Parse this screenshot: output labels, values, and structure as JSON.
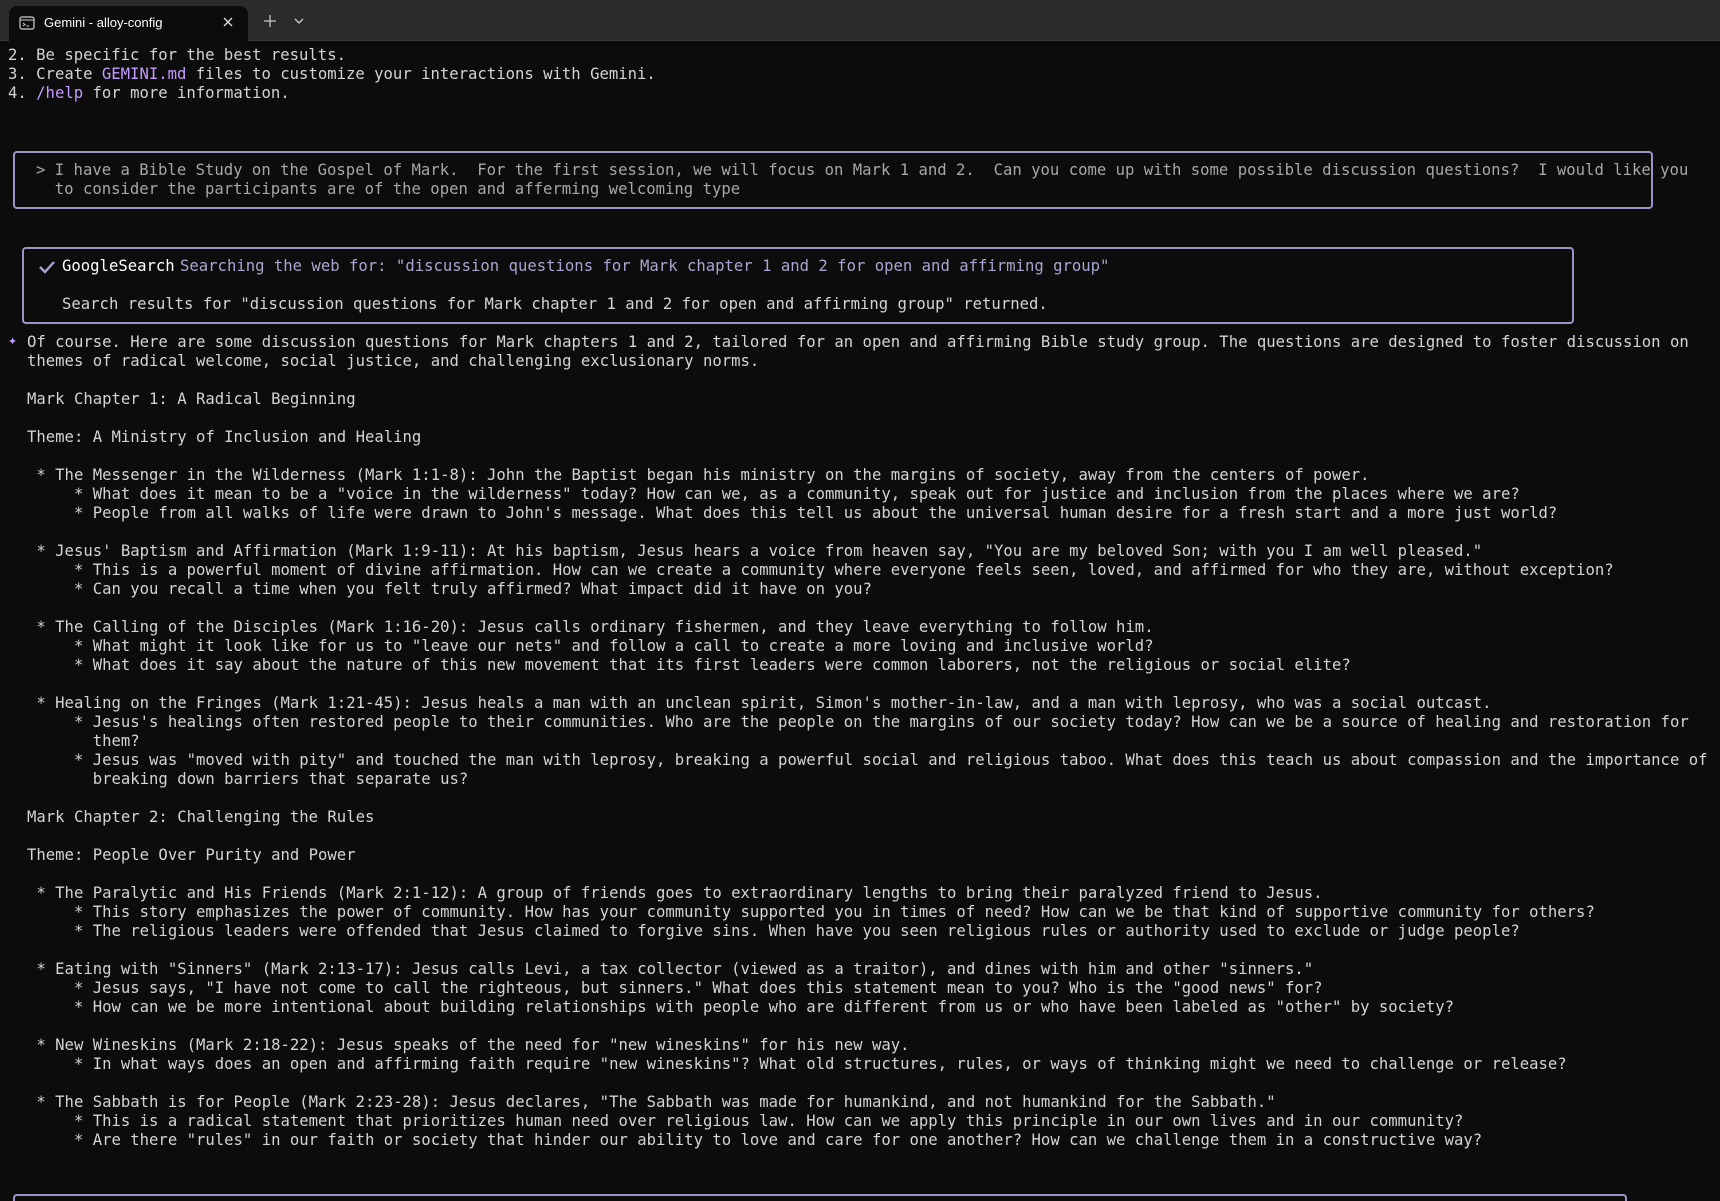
{
  "window": {
    "tab_title": "Gemini - alloy-config",
    "icons": {
      "tab": "terminal-icon",
      "close": "close-icon",
      "new_tab": "plus-icon",
      "dropdown": "chevron-down-icon"
    }
  },
  "colors": {
    "background": "#0c0c0c",
    "accent": "#c49bff",
    "box_border": "#9a95c9"
  },
  "tips": {
    "line2": "2. Be specific for the best results.",
    "line3_prefix": "3. Create ",
    "line3_link": "GEMINI.md",
    "line3_suffix": " files to customize your interactions with Gemini.",
    "line4_prefix": "4. ",
    "line4_link": "/help",
    "line4_suffix": " for more information."
  },
  "user_prompt": {
    "line1": "> I have a Bible Study on the Gospel of Mark.  For the first session, we will focus on Mark 1 and 2.  Can you come up with some possible discussion questions?  I would like you",
    "line2": "  to consider the participants are of the open and afferming welcoming type"
  },
  "tool_call": {
    "name": "GoogleSearch",
    "description": "Searching the web for: \"discussion questions for Mark chapter 1 and 2 for open and affirming group\"",
    "result": "Search results for \"discussion questions for Mark chapter 1 and 2 for open and affirming group\" returned."
  },
  "response": {
    "intro1": "Of course. Here are some discussion questions for Mark chapters 1 and 2, tailored for an open and affirming Bible study group. The questions are designed to foster discussion on",
    "intro2": "themes of radical welcome, social justice, and challenging exclusionary norms.",
    "ch1_heading": "Mark Chapter 1: A Radical Beginning",
    "ch1_theme": "Theme: A Ministry of Inclusion and Healing",
    "ch2_heading": "Mark Chapter 2: Challenging the Rules",
    "ch2_theme": "Theme: People Over Purity and Power",
    "lines": [
      " * The Messenger in the Wilderness (Mark 1:1-8): John the Baptist began his ministry on the margins of society, away from the centers of power.",
      "     * What does it mean to be a \"voice in the wilderness\" today? How can we, as a community, speak out for justice and inclusion from the places where we are?",
      "     * People from all walks of life were drawn to John's message. What does this tell us about the universal human desire for a fresh start and a more just world?",
      " * Jesus' Baptism and Affirmation (Mark 1:9-11): At his baptism, Jesus hears a voice from heaven say, \"You are my beloved Son; with you I am well pleased.\"",
      "     * This is a powerful moment of divine affirmation. How can we create a community where everyone feels seen, loved, and affirmed for who they are, without exception?",
      "     * Can you recall a time when you felt truly affirmed? What impact did it have on you?",
      " * The Calling of the Disciples (Mark 1:16-20): Jesus calls ordinary fishermen, and they leave everything to follow him.",
      "     * What might it look like for us to \"leave our nets\" and follow a call to create a more loving and inclusive world?",
      "     * What does it say about the nature of this new movement that its first leaders were common laborers, not the religious or social elite?",
      " * Healing on the Fringes (Mark 1:21-45): Jesus heals a man with an unclean spirit, Simon's mother-in-law, and a man with leprosy, who was a social outcast.",
      "     * Jesus's healings often restored people to their communities. Who are the people on the margins of our society today? How can we be a source of healing and restoration for",
      "       them?",
      "     * Jesus was \"moved with pity\" and touched the man with leprosy, breaking a powerful social and religious taboo. What does this teach us about compassion and the importance of",
      "       breaking down barriers that separate us?",
      " * The Paralytic and His Friends (Mark 2:1-12): A group of friends goes to extraordinary lengths to bring their paralyzed friend to Jesus.",
      "     * This story emphasizes the power of community. How has your community supported you in times of need? How can we be that kind of supportive community for others?",
      "     * The religious leaders were offended that Jesus claimed to forgive sins. When have you seen religious rules or authority used to exclude or judge people?",
      " * Eating with \"Sinners\" (Mark 2:13-17): Jesus calls Levi, a tax collector (viewed as a traitor), and dines with him and other \"sinners.\"",
      "     * Jesus says, \"I have not come to call the righteous, but sinners.\" What does this statement mean to you? Who is the \"good news\" for?",
      "     * How can we be more intentional about building relationships with people who are different from us or who have been labeled as \"other\" by society?",
      " * New Wineskins (Mark 2:18-22): Jesus speaks of the need for \"new wineskins\" for his new way.",
      "     * In what ways does an open and affirming faith require \"new wineskins\"? What old structures, rules, or ways of thinking might we need to challenge or release?",
      " * The Sabbath is for People (Mark 2:23-28): Jesus declares, \"The Sabbath was made for humankind, and not humankind for the Sabbath.\"",
      "     * This is a radical statement that prioritizes human need over religious law. How can we apply this principle in our own lives and in our community?",
      "     * Are there \"rules\" in our faith or society that hinder our ability to love and care for one another? How can we challenge them in a constructive way?"
    ]
  }
}
